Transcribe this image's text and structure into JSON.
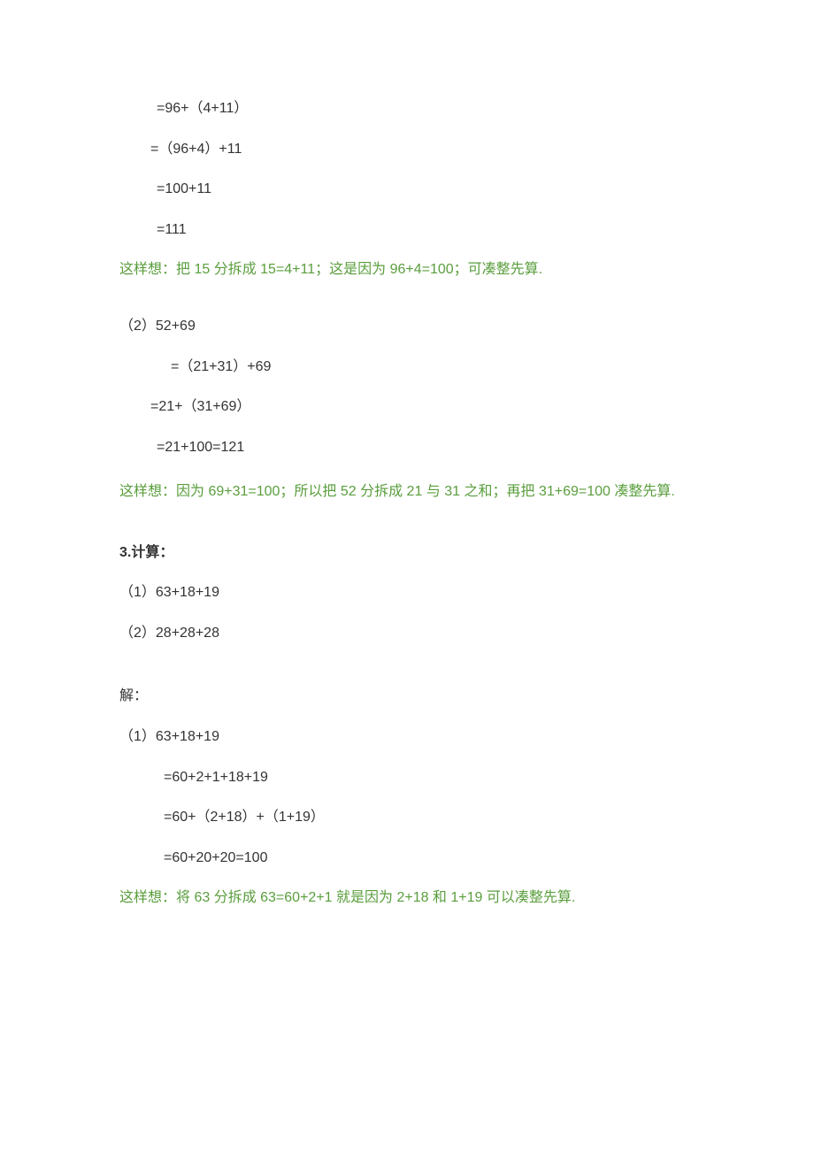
{
  "problem1": {
    "step1": "=96+（4+11）",
    "step2": "=（96+4）+11",
    "step3": "=100+11",
    "step4": "=111",
    "explanation": "这样想：把 15 分拆成 15=4+11；这是因为 96+4=100；可凑整先算."
  },
  "problem2": {
    "title": "（2）52+69",
    "step1": "=（21+31）+69",
    "step2": "=21+（31+69）",
    "step3": "=21+100=121",
    "explanation": "这样想：因为 69+31=100；所以把 52 分拆成 21 与 31 之和；再把 31+69=100 凑整先算."
  },
  "problem3": {
    "heading": "3.计算：",
    "q1": "（1）63+18+19",
    "q2": "（2）28+28+28",
    "answerLabel": "解：",
    "a1title": "（1）63+18+19",
    "a1step1": "=60+2+1+18+19",
    "a1step2": "=60+（2+18）+（1+19）",
    "a1step3": "=60+20+20=100",
    "explanation": "这样想：将 63 分拆成 63=60+2+1 就是因为 2+18 和 1+19 可以凑整先算."
  }
}
